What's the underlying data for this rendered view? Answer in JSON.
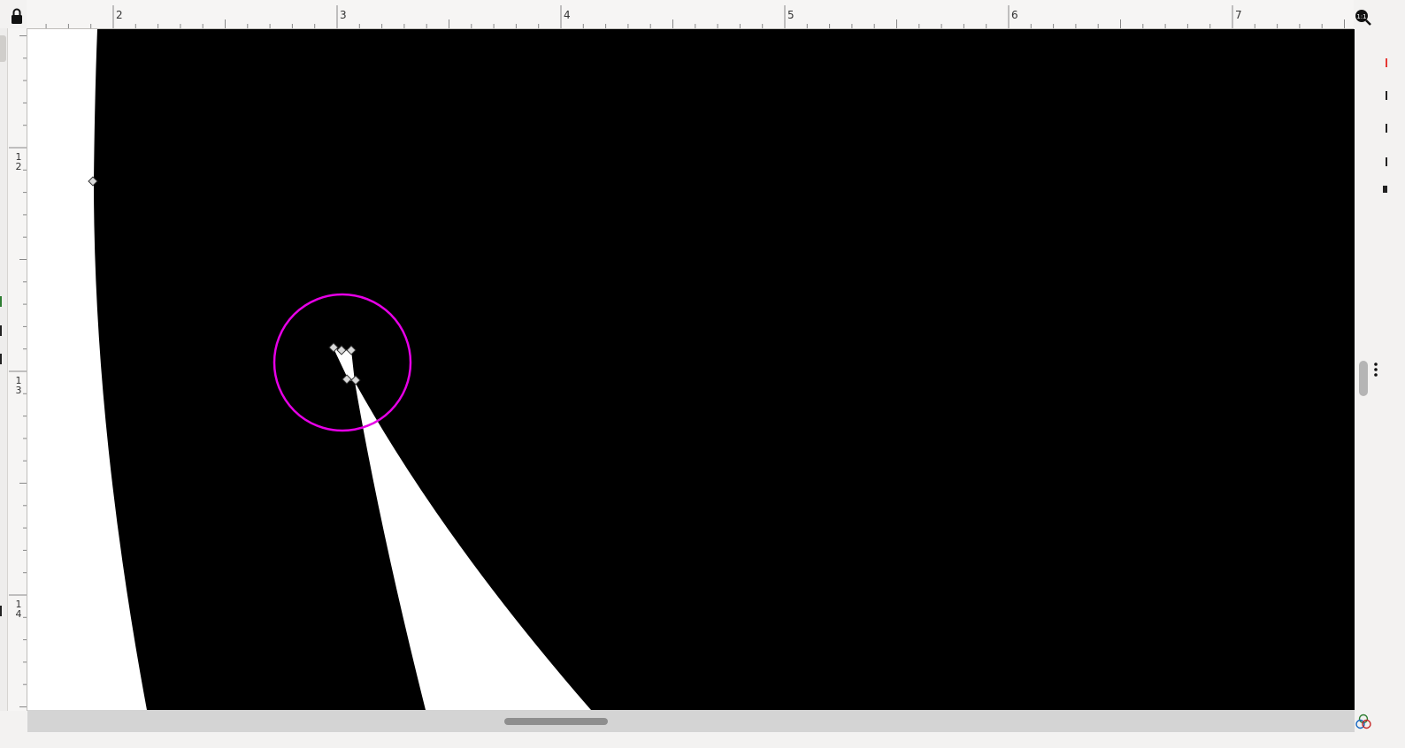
{
  "rulers": {
    "horizontal_labels": [
      "2",
      "3",
      "4",
      "5",
      "6",
      "7"
    ],
    "vertical_labels": [
      {
        "lines": [
          "1",
          "2"
        ]
      },
      {
        "lines": [
          "1",
          "3"
        ]
      },
      {
        "lines": [
          "1",
          "4"
        ]
      }
    ]
  },
  "icons": {
    "lock": "lock-icon",
    "zoom_one_to_one": "zoom-1-1-icon",
    "menu": "vertical-dots-icon",
    "color_management": "color-circles-icon"
  },
  "colors": {
    "shape_fill": "#000000",
    "canvas_background": "#ffffff",
    "selection_circle": "#e600e6",
    "node_handle": "#d9d9d9"
  }
}
